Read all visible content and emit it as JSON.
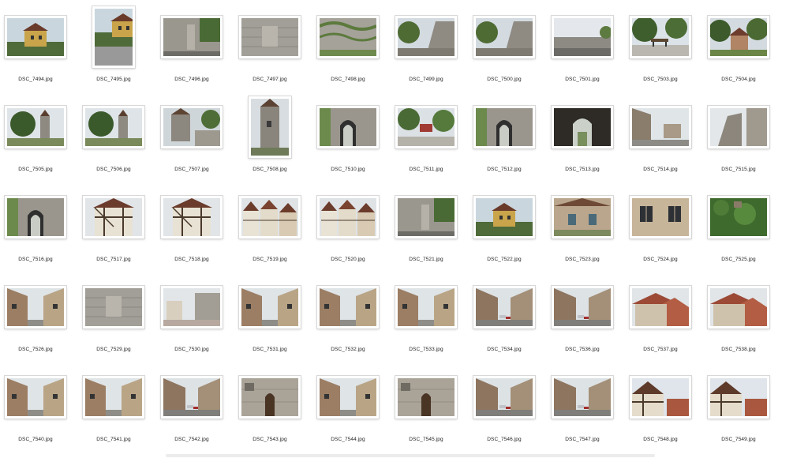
{
  "colors": {
    "background": "#ffffff",
    "label_text": "#222222"
  },
  "files": [
    {
      "name": "DSC_7494.jpg",
      "orientation": "landscape",
      "scene": "house-sky"
    },
    {
      "name": "DSC_7495.jpg",
      "orientation": "portrait",
      "scene": "house-sky"
    },
    {
      "name": "DSC_7496.jpg",
      "orientation": "landscape",
      "scene": "stone-wall-green"
    },
    {
      "name": "DSC_7497.jpg",
      "orientation": "landscape",
      "scene": "stone-wall"
    },
    {
      "name": "DSC_7498.jpg",
      "orientation": "landscape",
      "scene": "stone-wall-vines"
    },
    {
      "name": "DSC_7499.jpg",
      "orientation": "landscape",
      "scene": "trees-wall"
    },
    {
      "name": "DSC_7500.jpg",
      "orientation": "landscape",
      "scene": "trees-wall"
    },
    {
      "name": "DSC_7501.jpg",
      "orientation": "landscape",
      "scene": "wall-sky"
    },
    {
      "name": "DSC_7503.jpg",
      "orientation": "landscape",
      "scene": "park-bench"
    },
    {
      "name": "DSC_7504.jpg",
      "orientation": "landscape",
      "scene": "trees-house"
    },
    {
      "name": "DSC_7505.jpg",
      "orientation": "landscape",
      "scene": "tree-tower"
    },
    {
      "name": "DSC_7506.jpg",
      "orientation": "landscape",
      "scene": "tree-tower"
    },
    {
      "name": "DSC_7507.jpg",
      "orientation": "landscape",
      "scene": "tower-stairs"
    },
    {
      "name": "DSC_7508.jpg",
      "orientation": "portrait",
      "scene": "tower"
    },
    {
      "name": "DSC_7510.jpg",
      "orientation": "landscape",
      "scene": "gate-arch"
    },
    {
      "name": "DSC_7511.jpg",
      "orientation": "landscape",
      "scene": "market-trees"
    },
    {
      "name": "DSC_7512.jpg",
      "orientation": "landscape",
      "scene": "gate-arch"
    },
    {
      "name": "DSC_7513.jpg",
      "orientation": "landscape",
      "scene": "dark-arch"
    },
    {
      "name": "DSC_7514.jpg",
      "orientation": "landscape",
      "scene": "street-sky"
    },
    {
      "name": "DSC_7515.jpg",
      "orientation": "landscape",
      "scene": "tower-sky"
    },
    {
      "name": "DSC_7516.jpg",
      "orientation": "landscape",
      "scene": "gate-arch"
    },
    {
      "name": "DSC_7517.jpg",
      "orientation": "landscape",
      "scene": "half-timber"
    },
    {
      "name": "DSC_7518.jpg",
      "orientation": "landscape",
      "scene": "half-timber"
    },
    {
      "name": "DSC_7519.jpg",
      "orientation": "landscape",
      "scene": "half-timber-row"
    },
    {
      "name": "DSC_7520.jpg",
      "orientation": "landscape",
      "scene": "half-timber-row"
    },
    {
      "name": "DSC_7521.jpg",
      "orientation": "landscape",
      "scene": "stone-wall-green"
    },
    {
      "name": "DSC_7522.jpg",
      "orientation": "landscape",
      "scene": "house-sky"
    },
    {
      "name": "DSC_7523.jpg",
      "orientation": "landscape",
      "scene": "house-window"
    },
    {
      "name": "DSC_7524.jpg",
      "orientation": "landscape",
      "scene": "windows-beige"
    },
    {
      "name": "DSC_7525.jpg",
      "orientation": "landscape",
      "scene": "green-vines"
    },
    {
      "name": "DSC_7526.jpg",
      "orientation": "landscape",
      "scene": "street-houses"
    },
    {
      "name": "DSC_7529.jpg",
      "orientation": "landscape",
      "scene": "stone-wall"
    },
    {
      "name": "DSC_7530.jpg",
      "orientation": "landscape",
      "scene": "street-wall"
    },
    {
      "name": "DSC_7531.jpg",
      "orientation": "landscape",
      "scene": "street-houses"
    },
    {
      "name": "DSC_7532.jpg",
      "orientation": "landscape",
      "scene": "street-houses"
    },
    {
      "name": "DSC_7533.jpg",
      "orientation": "landscape",
      "scene": "street-houses"
    },
    {
      "name": "DSC_7534.jpg",
      "orientation": "landscape",
      "scene": "street-cars"
    },
    {
      "name": "DSC_7536.jpg",
      "orientation": "landscape",
      "scene": "street-cars"
    },
    {
      "name": "DSC_7537.jpg",
      "orientation": "landscape",
      "scene": "rooftops"
    },
    {
      "name": "DSC_7538.jpg",
      "orientation": "landscape",
      "scene": "rooftops"
    },
    {
      "name": "DSC_7540.jpg",
      "orientation": "landscape",
      "scene": "street-houses"
    },
    {
      "name": "DSC_7541.jpg",
      "orientation": "landscape",
      "scene": "street-houses"
    },
    {
      "name": "DSC_7542.jpg",
      "orientation": "landscape",
      "scene": "street-cars"
    },
    {
      "name": "DSC_7543.jpg",
      "orientation": "landscape",
      "scene": "stone-door"
    },
    {
      "name": "DSC_7544.jpg",
      "orientation": "landscape",
      "scene": "street-houses"
    },
    {
      "name": "DSC_7545.jpg",
      "orientation": "landscape",
      "scene": "stone-door"
    },
    {
      "name": "DSC_7546.jpg",
      "orientation": "landscape",
      "scene": "street-cars"
    },
    {
      "name": "DSC_7547.jpg",
      "orientation": "landscape",
      "scene": "street-cars"
    },
    {
      "name": "DSC_7548.jpg",
      "orientation": "landscape",
      "scene": "half-timber-sky"
    },
    {
      "name": "DSC_7549.jpg",
      "orientation": "landscape",
      "scene": "half-timber-sky"
    }
  ]
}
